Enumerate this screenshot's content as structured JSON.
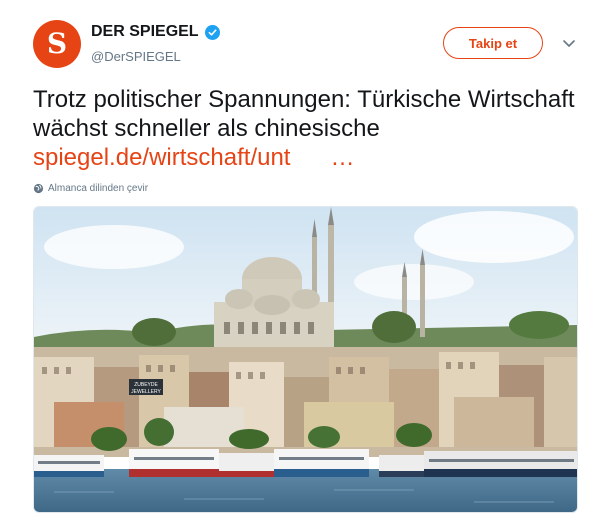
{
  "account": {
    "display_name": "DER SPIEGEL",
    "handle": "@DerSPIEGEL",
    "avatar_letter": "S",
    "verified": true
  },
  "follow_button": {
    "label": "Takip et"
  },
  "tweet": {
    "text": "Trotz politischer Spannungen: Türkische Wirtschaft wächst schneller als chinesische",
    "link_text": "spiegel.de/wirtschaft/unt",
    "link_ellipsis": "…",
    "translate_label": "Almanca dilinden çevir"
  },
  "photo": {
    "sign_text": "ZUBEYDE\nJEWELLERY"
  },
  "colors": {
    "brand": "#e64415",
    "verified": "#1da1f2",
    "muted": "#657786"
  }
}
